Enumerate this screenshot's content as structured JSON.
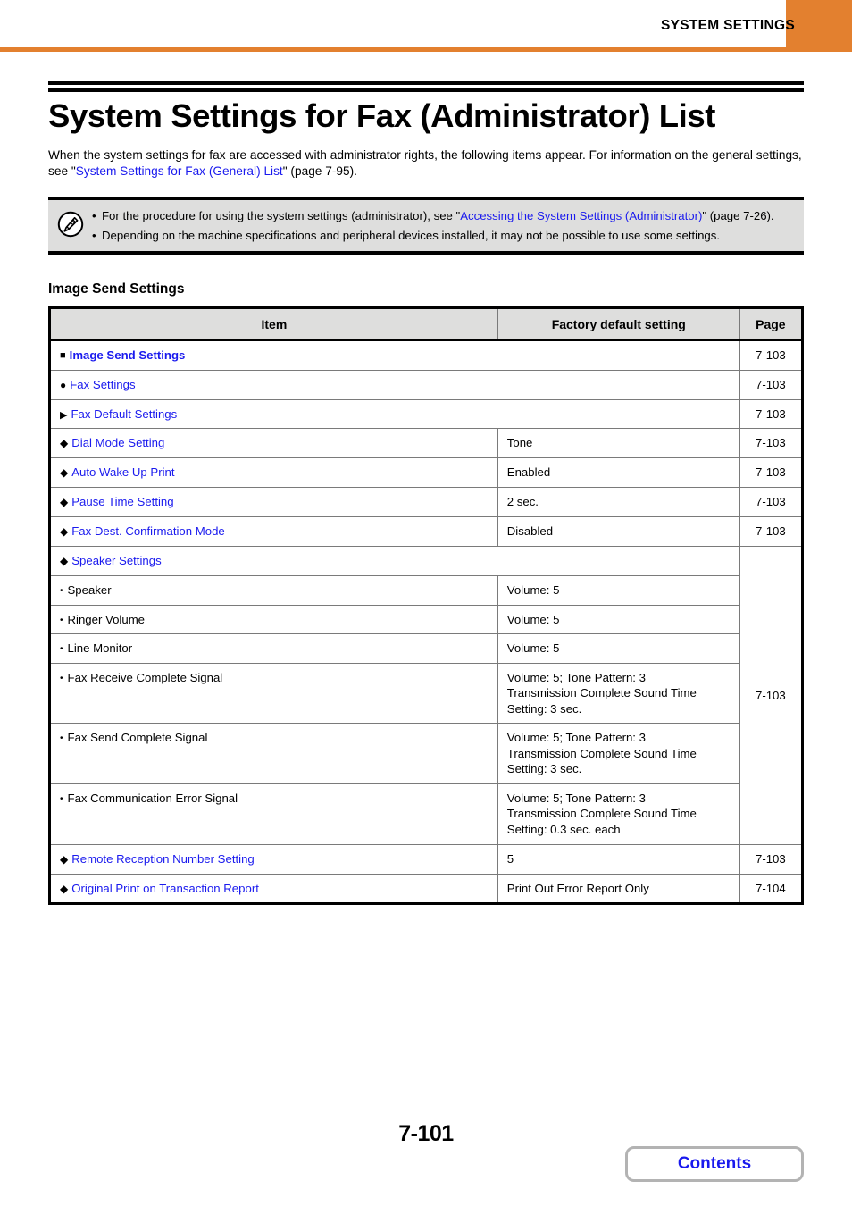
{
  "header": {
    "title": "SYSTEM SETTINGS",
    "accent_color": "#e3802f"
  },
  "page": {
    "doc_title": "System Settings for Fax (Administrator) List",
    "intro_part1": "When the system settings for fax are accessed with administrator rights, the following items appear. For information on the general settings, see \"",
    "intro_link": "System Settings for Fax (General) List",
    "intro_part2": "\" (page 7-95).",
    "link_color": "#1a1aee"
  },
  "note": {
    "icon": "note-pencil-icon",
    "bullet": "•",
    "items": [
      {
        "text_before": "For the procedure for using the system settings (administrator), see \"",
        "link": "Accessing the System Settings (Administrator)",
        "text_after": "\" (page 7-26)."
      },
      {
        "text_before": "Depending on the machine specifications and peripheral devices installed, it may not be possible to use some settings.",
        "link": "",
        "text_after": ""
      }
    ]
  },
  "section": {
    "heading": "Image Send Settings"
  },
  "table": {
    "columns": [
      "Item",
      "Factory default setting",
      "Page"
    ],
    "rows": [
      {
        "marker": "■",
        "level": 1,
        "label": "Image Send Settings",
        "bold": true,
        "span": true,
        "default": "",
        "page": "7-103"
      },
      {
        "marker": "●",
        "level": 2,
        "label": "Fax Settings",
        "bold": false,
        "span": true,
        "default": "",
        "page": "7-103"
      },
      {
        "marker": "▶",
        "level": 3,
        "label": "Fax Default Settings",
        "bold": false,
        "span": true,
        "default": "",
        "page": "7-103"
      },
      {
        "marker": "◆",
        "level": 4,
        "label": "Dial Mode Setting",
        "bold": false,
        "span": false,
        "default": "Tone",
        "page": "7-103"
      },
      {
        "marker": "◆",
        "level": 4,
        "label": "Auto Wake Up Print",
        "bold": false,
        "span": false,
        "default": "Enabled",
        "page": "7-103"
      },
      {
        "marker": "◆",
        "level": 4,
        "label": "Pause Time Setting",
        "bold": false,
        "span": false,
        "default": "2 sec.",
        "page": "7-103"
      },
      {
        "marker": "◆",
        "level": 4,
        "label": "Fax Dest. Confirmation Mode",
        "bold": false,
        "span": false,
        "default": "Disabled",
        "page": "7-103"
      },
      {
        "marker": "◆",
        "level": 4,
        "label": "Speaker Settings",
        "bold": false,
        "span": true,
        "default": "",
        "page": "7-103",
        "page_rowspan": 7
      },
      {
        "marker": "•",
        "level": 5,
        "label": "Speaker",
        "plain": true,
        "bold": false,
        "span": false,
        "default": "Volume: 5",
        "page": null
      },
      {
        "marker": "•",
        "level": 5,
        "label": "Ringer Volume",
        "plain": true,
        "bold": false,
        "span": false,
        "default": "Volume: 5",
        "page": null
      },
      {
        "marker": "•",
        "level": 5,
        "label": "Line Monitor",
        "plain": true,
        "bold": false,
        "span": false,
        "default": "Volume: 5",
        "page": null
      },
      {
        "marker": "•",
        "level": 5,
        "label": "Fax Receive Complete Signal",
        "plain": true,
        "bold": false,
        "span": false,
        "default": "Volume: 5; Tone Pattern: 3\nTransmission Complete Sound Time\nSetting: 3 sec.",
        "page": null
      },
      {
        "marker": "•",
        "level": 5,
        "label": "Fax Send Complete Signal",
        "plain": true,
        "bold": false,
        "span": false,
        "default": "Volume: 5; Tone Pattern: 3\nTransmission Complete Sound Time\nSetting: 3 sec.",
        "page": null
      },
      {
        "marker": "•",
        "level": 5,
        "label": "Fax Communication Error Signal",
        "plain": true,
        "bold": false,
        "span": false,
        "default": "Volume: 5; Tone Pattern: 3\nTransmission Complete Sound Time\nSetting: 0.3 sec. each",
        "page": null
      },
      {
        "marker": "◆",
        "level": 4,
        "label": "Remote Reception Number Setting",
        "bold": false,
        "span": false,
        "default": "5",
        "page": "7-103"
      },
      {
        "marker": "◆",
        "level": 4,
        "label": "Original Print on Transaction Report",
        "bold": false,
        "span": false,
        "default": "Print Out Error Report Only",
        "page": "7-104"
      }
    ]
  },
  "footer": {
    "page_number": "7-101",
    "contents_label": "Contents"
  }
}
